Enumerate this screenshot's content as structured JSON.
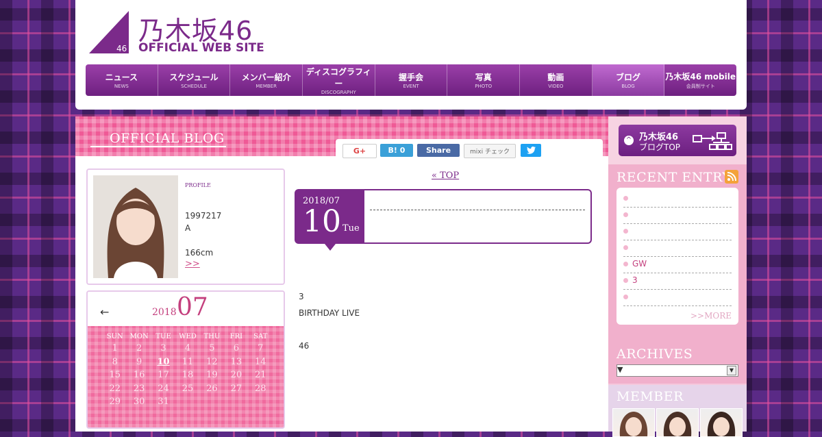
{
  "header": {
    "logo_title": "乃木坂46",
    "logo_sub": "OFFICIAL WEB SITE",
    "logo_small": "46"
  },
  "nav": [
    {
      "label": "ニュース",
      "sub": "NEWS"
    },
    {
      "label": "スケジュール",
      "sub": "SCHEDULE"
    },
    {
      "label": "メンバー紹介",
      "sub": "MEMBER"
    },
    {
      "label": "ディスコグラフィー",
      "sub": "DISCOGRAPHY"
    },
    {
      "label": "握手会",
      "sub": "EVENT"
    },
    {
      "label": "写真",
      "sub": "PHOTO"
    },
    {
      "label": "動画",
      "sub": "VIDEO"
    },
    {
      "label": "ブログ",
      "sub": "BLOG"
    },
    {
      "label": "乃木坂46 mobile",
      "sub": "会員制サイト"
    }
  ],
  "blog": {
    "title": "OFFICIAL BLOG",
    "share": {
      "gplus": "G+",
      "hatena": "B! 0",
      "facebook": "Share",
      "mixi": "mixi チェック",
      "twitter": "🐦"
    }
  },
  "profile": {
    "label": "PROFILE",
    "birthday": "1997217",
    "blood": "A",
    "height": "166cm",
    "more": ">>"
  },
  "calendar": {
    "prev": "←",
    "year": "2018",
    "month": "07",
    "dow": [
      "SUN",
      "MON",
      "TUE",
      "WED",
      "THU",
      "FRI",
      "SAT"
    ],
    "days": [
      "1",
      "2",
      "3",
      "4",
      "5",
      "6",
      "7",
      "8",
      "9",
      "10",
      "11",
      "12",
      "13",
      "14",
      "15",
      "16",
      "17",
      "18",
      "19",
      "20",
      "21",
      "22",
      "23",
      "24",
      "25",
      "26",
      "27",
      "28",
      "29",
      "30",
      "31"
    ]
  },
  "post": {
    "top_link": "« TOP",
    "date_ym": "2018/07",
    "date_d": "10",
    "date_dow": "Tue",
    "lines": [
      "3",
      "BIRTHDAY LIVE",
      "46"
    ]
  },
  "sidebar": {
    "blogtop_l1": "乃木坂46",
    "blogtop_l2": "ブログTOP",
    "recent_title": "RECENT ENTRY",
    "recent": [
      "",
      "",
      "",
      "",
      "GW",
      "3",
      ""
    ],
    "more": ">>MORE",
    "archives_title": "ARCHIVES",
    "archives_value": "▼",
    "member_title": "MEMBER"
  }
}
